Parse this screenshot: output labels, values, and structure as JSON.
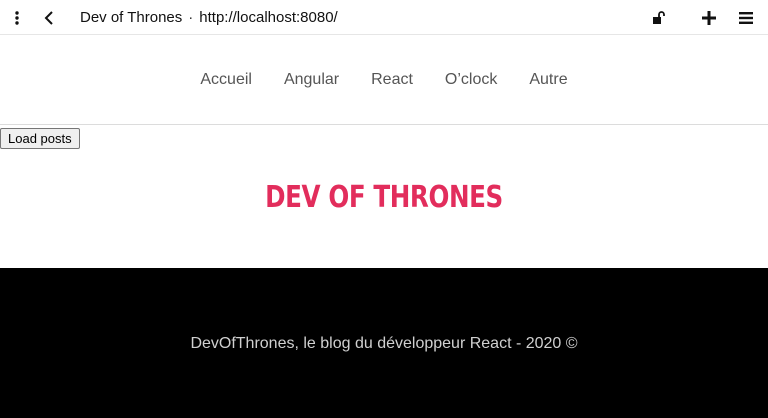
{
  "browser": {
    "page_title": "Dev of Thrones",
    "separator": "·",
    "url": "http://localhost:8080/",
    "icons": {
      "menu": "more-vertical-icon",
      "back": "chevron-left-icon",
      "lock": "unlock-icon",
      "new_tab": "plus-icon",
      "main_menu": "hamburger-icon"
    }
  },
  "nav": {
    "items": [
      {
        "label": "Accueil"
      },
      {
        "label": "Angular"
      },
      {
        "label": "React"
      },
      {
        "label": "O’clock"
      },
      {
        "label": "Autre"
      }
    ]
  },
  "actions": {
    "load_posts_label": "Load posts"
  },
  "hero": {
    "title": "DEV OF THRONES"
  },
  "footer": {
    "text": "DevOfThrones, le blog du développeur React - 2020 ©"
  },
  "colors": {
    "accent": "#e22d5c",
    "footer_bg": "#000000",
    "footer_text": "#d0d0d0",
    "nav_text": "#555555"
  }
}
